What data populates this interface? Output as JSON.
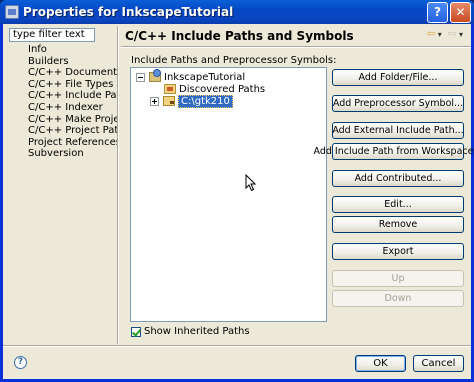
{
  "window": {
    "title": "Properties for InkscapeTutorial",
    "help_glyph": "?",
    "close_glyph": "✕"
  },
  "filter": {
    "value": "type filter text"
  },
  "nav": {
    "items": [
      {
        "label": "Info"
      },
      {
        "label": "Builders"
      },
      {
        "label": "C/C++ Documentation"
      },
      {
        "label": "C/C++ File Types"
      },
      {
        "label": "C/C++ Include Paths and",
        "selected": true
      },
      {
        "label": "C/C++ Indexer"
      },
      {
        "label": "C/C++ Make Project"
      },
      {
        "label": "C/C++ Project Paths"
      },
      {
        "label": "Project References"
      },
      {
        "label": "Subversion"
      }
    ]
  },
  "page": {
    "title": "C/C++ Include Paths and Symbols",
    "back_glyph": "⇦",
    "forward_glyph": "⇨",
    "menu_glyph": "▾"
  },
  "section": {
    "label": "Include Paths and Preprocessor Symbols:"
  },
  "tree": {
    "root": {
      "label": "InkscapeTutorial",
      "icon": "project-icon"
    },
    "children": [
      {
        "label": "Discovered Paths",
        "icon": "discovered-paths-icon"
      },
      {
        "label": "C:\\gtk210",
        "icon": "folder-icon",
        "selected": true
      }
    ]
  },
  "buttons": {
    "add_folder": "Add Folder/File...",
    "add_symbol": "Add Preprocessor Symbol...",
    "add_external": "Add External Include Path...",
    "add_workspace": "Add Include Path from Workspace...",
    "add_contributed": "Add Contributed...",
    "edit": "Edit...",
    "remove": "Remove",
    "export": "Export",
    "up": "Up",
    "down": "Down"
  },
  "options": {
    "show_inherited_label": "Show Inherited Paths",
    "show_inherited_checked": true
  },
  "dialog": {
    "help_glyph": "?",
    "ok": "OK",
    "cancel": "Cancel"
  }
}
